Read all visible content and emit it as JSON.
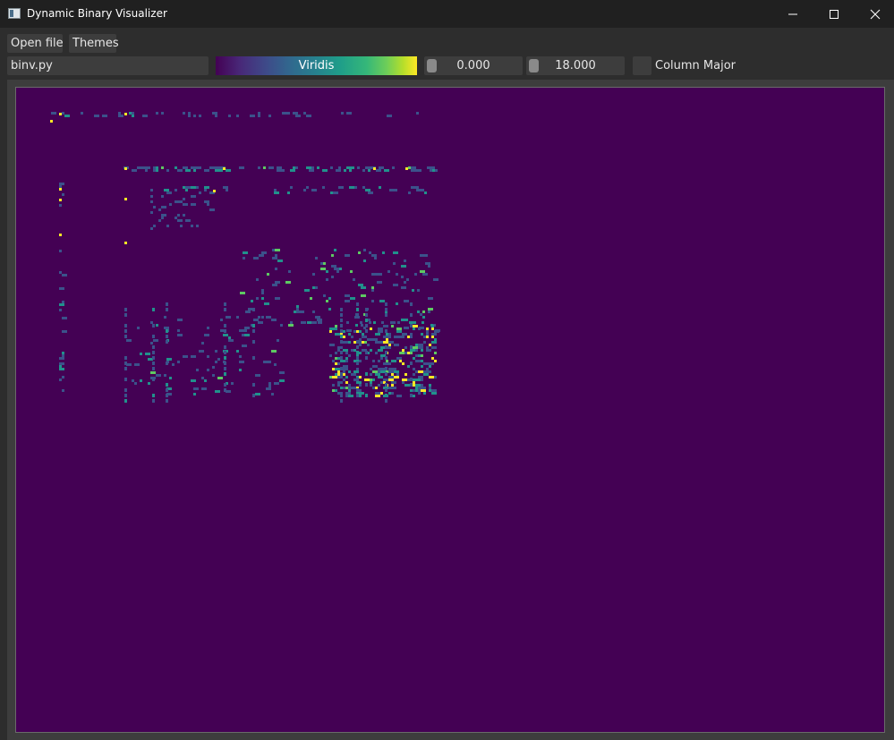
{
  "window": {
    "title": "Dynamic Binary Visualizer"
  },
  "menu": {
    "open_file_label": "Open file",
    "themes_label": "Themes"
  },
  "toolbar": {
    "file_path": "binv.py",
    "colormap_name": "Viridis",
    "min_value": "0.000",
    "max_value": "18.000",
    "column_major_label": "Column Major",
    "column_major_checked": false
  },
  "colors": {
    "background": "#440154",
    "low": "#3b528b",
    "mid": "#21918c",
    "high": "#5ec962",
    "max": "#fde725"
  },
  "icons": {
    "app": "app-icon",
    "minimize": "minimize-icon",
    "maximize": "maximize-icon",
    "close": "close-icon"
  }
}
